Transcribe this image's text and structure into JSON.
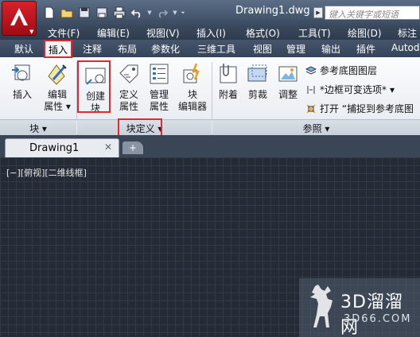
{
  "window": {
    "title": "Drawing1.dwg",
    "search_placeholder": "键入关键字或短语"
  },
  "menu": [
    {
      "label": "文件(F)"
    },
    {
      "label": "编辑(E)"
    },
    {
      "label": "视图(V)"
    },
    {
      "label": "插入(I)"
    },
    {
      "label": "格式(O)"
    },
    {
      "label": "工具(T)"
    },
    {
      "label": "绘图(D)"
    },
    {
      "label": "标注"
    }
  ],
  "ribbon_tabs": [
    {
      "label": "默认"
    },
    {
      "label": "插入",
      "active": true
    },
    {
      "label": "注释"
    },
    {
      "label": "布局"
    },
    {
      "label": "参数化"
    },
    {
      "label": "三维工具"
    },
    {
      "label": "视图"
    },
    {
      "label": "管理"
    },
    {
      "label": "输出"
    },
    {
      "label": "插件"
    },
    {
      "label": "Autod"
    }
  ],
  "ribbon": {
    "block_panel": {
      "insert": "插入",
      "edit_attr_1": "编辑",
      "edit_attr_2": "属性",
      "footer": "块 ▾"
    },
    "block_def_panel": {
      "create_1": "创建",
      "create_2": "块",
      "define_1": "定义",
      "define_2": "属性",
      "manage_1": "管理",
      "manage_2": "属性",
      "editor_1": "块",
      "editor_2": "编辑器",
      "footer": "块定义 ▾"
    },
    "reference_panel": {
      "attach": "附着",
      "clip": "剪裁",
      "adjust": "调整",
      "underlay_layers": "参考底图图层",
      "frame_option": "*边框可变选项*",
      "snap_option": "打开 “捕捉到参考底图",
      "footer": "参照 ▾"
    }
  },
  "file_tab": {
    "name": "Drawing1",
    "close": "✕",
    "new": "+"
  },
  "viewport": {
    "label": "[−][俯视][二维线框]"
  },
  "watermark": {
    "brand": "3D溜溜网",
    "site": "3D66.COM"
  },
  "colors": {
    "highlight_box": "#e0282e",
    "app_button": "#c81820",
    "canvas": "#252b35"
  }
}
